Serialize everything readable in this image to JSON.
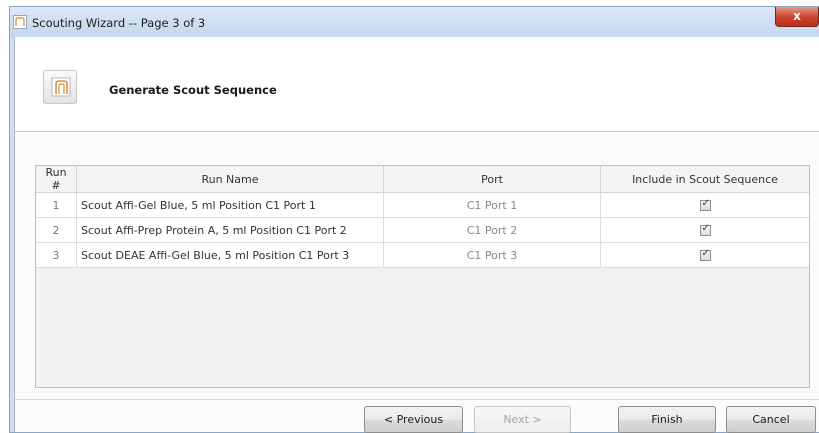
{
  "window": {
    "title": "Scouting Wizard -- Page 3 of 3",
    "close_glyph": "x"
  },
  "header": {
    "title": "Generate Scout Sequence",
    "icon": "wizard-icon"
  },
  "grid": {
    "columns": [
      "Run #",
      "Run Name",
      "Port",
      "Include in Scout Sequence"
    ],
    "rows": [
      {
        "run": "1",
        "name": "Scout Affi-Gel Blue, 5 ml Position C1 Port 1",
        "port": "C1 Port 1",
        "include": true
      },
      {
        "run": "2",
        "name": "Scout Affi-Prep Protein A, 5 ml Position C1 Port 2",
        "port": "C1 Port 2",
        "include": true
      },
      {
        "run": "3",
        "name": "Scout DEAE Affi-Gel Blue, 5 ml  Position C1 Port 3",
        "port": "C1 Port 3",
        "include": true
      }
    ]
  },
  "buttons": {
    "previous": "< Previous",
    "next": "Next >",
    "finish": "Finish",
    "cancel": "Cancel"
  },
  "colors": {
    "close_button": "#c9402a",
    "window_frame": "#cfdff0"
  }
}
